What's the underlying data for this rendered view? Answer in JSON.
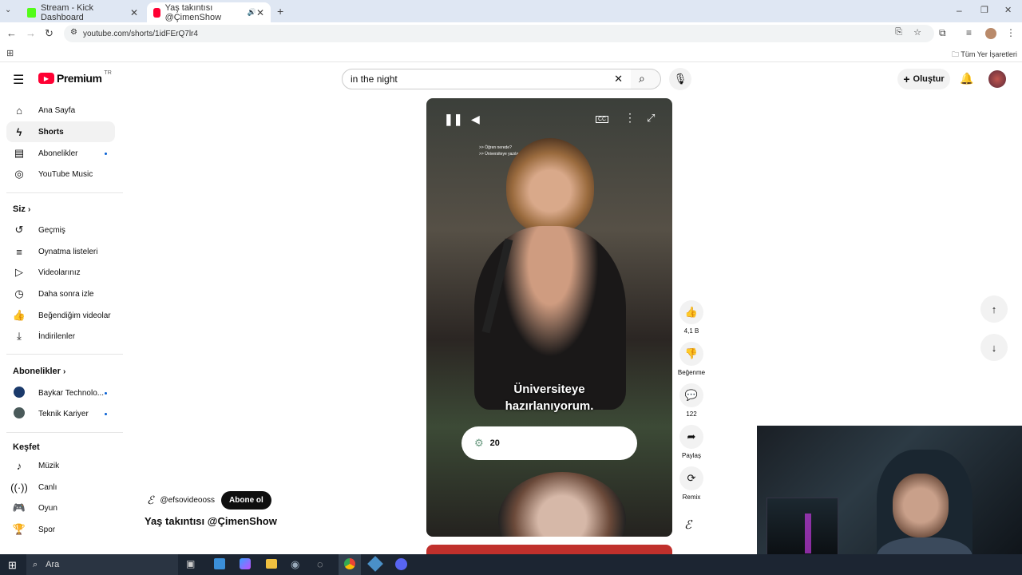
{
  "browser": {
    "tabs": [
      {
        "title": "Stream - Kick Dashboard",
        "active": false
      },
      {
        "title": "Yaş takıntısı @ÇimenShow",
        "active": true
      }
    ],
    "url": "youtube.com/shorts/1idFErQ7lr4",
    "bookmarks_label": "Tüm Yer İşaretleri"
  },
  "header": {
    "logo": "Premium",
    "region": "TR",
    "search_value": "in the night",
    "create_label": "Oluştur"
  },
  "sidebar": {
    "main": [
      {
        "label": "Ana Sayfa",
        "icon": "home-icon"
      },
      {
        "label": "Shorts",
        "icon": "shorts-icon",
        "selected": true
      },
      {
        "label": "Abonelikler",
        "icon": "subscriptions-icon",
        "dot": true
      },
      {
        "label": "YouTube Music",
        "icon": "music-icon"
      }
    ],
    "you_title": "Siz",
    "you": [
      {
        "label": "Geçmiş",
        "icon": "history-icon"
      },
      {
        "label": "Oynatma listeleri",
        "icon": "playlists-icon"
      },
      {
        "label": "Videolarınız",
        "icon": "your-videos-icon"
      },
      {
        "label": "Daha sonra izle",
        "icon": "watch-later-icon"
      },
      {
        "label": "Beğendiğim videolar",
        "icon": "liked-icon"
      },
      {
        "label": "İndirilenler",
        "icon": "download-icon"
      }
    ],
    "subs_title": "Abonelikler",
    "subs": [
      {
        "label": "Baykar Technolo...",
        "dot": true
      },
      {
        "label": "Teknik Kariyer",
        "dot": true
      }
    ],
    "explore_title": "Keşfet",
    "explore": [
      {
        "label": "Müzik",
        "icon": "music-note-icon"
      },
      {
        "label": "Canlı",
        "icon": "live-icon"
      },
      {
        "label": "Oyun",
        "icon": "gaming-icon"
      },
      {
        "label": "Spor",
        "icon": "trophy-icon"
      }
    ]
  },
  "short": {
    "caption_small_1": ">> Öğren nerede?",
    "caption_small_2": ">> Üniversiteye yazılanıyorum.",
    "caption_line_1": "Üniversiteye",
    "caption_line_2": "hazırlanıyorum.",
    "pill_text": "20",
    "channel": "@efsovideooss",
    "subscribe": "Abone ol",
    "title": "Yaş takıntısı @ÇimenShow",
    "likes": "4,1 B",
    "dislike_label": "Beğenme",
    "comments": "122",
    "share_label": "Paylaş",
    "remix_label": "Remix"
  },
  "taskbar": {
    "search_label": "Ara"
  }
}
